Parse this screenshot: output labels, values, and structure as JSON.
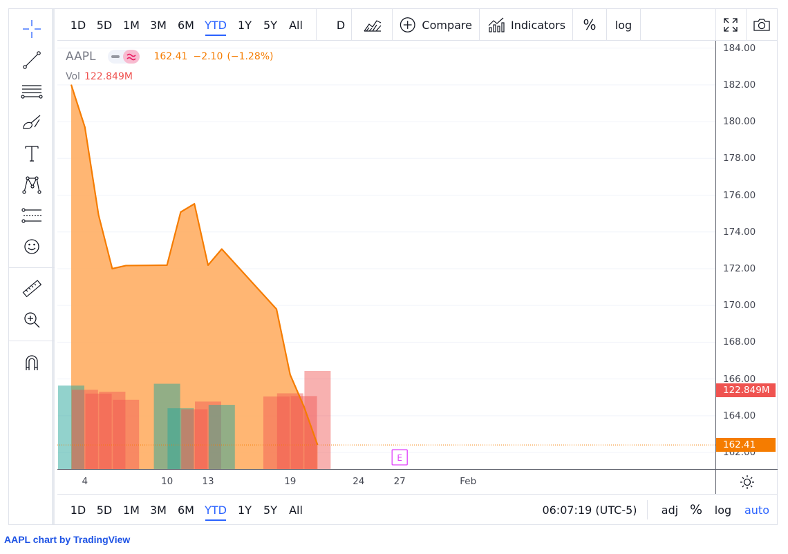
{
  "ticker": {
    "symbol": "AAPL",
    "price": "162.41",
    "change": "−2.10",
    "change_pct": "(−1.28%)",
    "volume_label": "Vol",
    "volume_value": "122.849M"
  },
  "top_toolbar": {
    "ranges": [
      "1D",
      "5D",
      "1M",
      "3M",
      "6M",
      "YTD",
      "1Y",
      "5Y",
      "All"
    ],
    "active_range": "YTD",
    "interval": "D",
    "compare_label": "Compare",
    "indicators_label": "Indicators",
    "percent_label": "%",
    "log_label": "log"
  },
  "bottom_toolbar": {
    "ranges": [
      "1D",
      "5D",
      "1M",
      "3M",
      "6M",
      "YTD",
      "1Y",
      "5Y",
      "All"
    ],
    "active_range": "YTD",
    "clock": "06:07:19 (UTC-5)",
    "adj_label": "adj",
    "percent_label": "%",
    "log_label": "log",
    "auto_label": "auto"
  },
  "left_toolbar": {
    "icons": [
      "crosshair-icon",
      "trend-line-icon",
      "fib-retracement-icon",
      "brush-icon",
      "text-icon",
      "pattern-icon",
      "forecast-icon",
      "emoji-icon",
      "ruler-icon",
      "zoom-in-icon",
      "magnet-icon"
    ]
  },
  "earnings_marker": "E",
  "colors": {
    "area_line": "#f57c00",
    "area_fill": "#ffa95a",
    "volume_up": "#26a69a",
    "volume_down": "#ef5350",
    "active": "#2962ff",
    "last_price_tag": "#f57c00",
    "volume_tag": "#ef5350",
    "earnings": "#e040fb"
  },
  "chart_data": {
    "type": "area",
    "price_axis": {
      "ylim": [
        161.1,
        184.4
      ],
      "ticks": [
        "184.00",
        "182.00",
        "180.00",
        "178.00",
        "176.00",
        "174.00",
        "172.00",
        "170.00",
        "168.00",
        "166.00",
        "164.00",
        "162.00"
      ]
    },
    "time_axis": {
      "ticks": [
        {
          "label": "4",
          "day": "Jan 4"
        },
        {
          "label": "10",
          "day": "Jan 10"
        },
        {
          "label": "13",
          "day": "Jan 13"
        },
        {
          "label": "19",
          "day": "Jan 19"
        },
        {
          "label": "24",
          "day": "Jan 24"
        },
        {
          "label": "27",
          "day": "Jan 27"
        },
        {
          "label": "Feb",
          "day": "Feb 1"
        }
      ]
    },
    "series": [
      {
        "x": [
          "Jan 3",
          "Jan 4",
          "Jan 5",
          "Jan 6",
          "Jan 7",
          "Jan 10",
          "Jan 11",
          "Jan 12",
          "Jan 13",
          "Jan 14",
          "Jan 18",
          "Jan 19",
          "Jan 20",
          "Jan 21"
        ],
        "values": [
          182.01,
          179.7,
          174.92,
          172.0,
          172.17,
          172.19,
          175.08,
          175.53,
          172.19,
          173.07,
          169.8,
          166.23,
          164.51,
          162.41
        ]
      }
    ],
    "volume": [
      {
        "day": "Jan 3",
        "value": 104.5,
        "dir": "up"
      },
      {
        "day": "Jan 4",
        "value": 99.3,
        "dir": "down"
      },
      {
        "day": "Jan 5",
        "value": 94.5,
        "dir": "down"
      },
      {
        "day": "Jan 6",
        "value": 96.9,
        "dir": "down"
      },
      {
        "day": "Jan 7",
        "value": 86.7,
        "dir": "down"
      },
      {
        "day": "Jan 10",
        "value": 106.8,
        "dir": "up"
      },
      {
        "day": "Jan 11",
        "value": 76.1,
        "dir": "up"
      },
      {
        "day": "Jan 12",
        "value": 74.8,
        "dir": "down"
      },
      {
        "day": "Jan 13",
        "value": 84.5,
        "dir": "down"
      },
      {
        "day": "Jan 14",
        "value": 80.4,
        "dir": "up"
      },
      {
        "day": "Jan 18",
        "value": 90.9,
        "dir": "down"
      },
      {
        "day": "Jan 19",
        "value": 94.8,
        "dir": "down"
      },
      {
        "day": "Jan 20",
        "value": 91.4,
        "dir": "down"
      },
      {
        "day": "Jan 21",
        "value": 122.849,
        "dir": "down"
      }
    ],
    "last_price": 162.41,
    "earnings_day": "Jan 27",
    "grid": true
  },
  "credit": {
    "symbol": "AAPL",
    "text": "chart by TradingView"
  }
}
